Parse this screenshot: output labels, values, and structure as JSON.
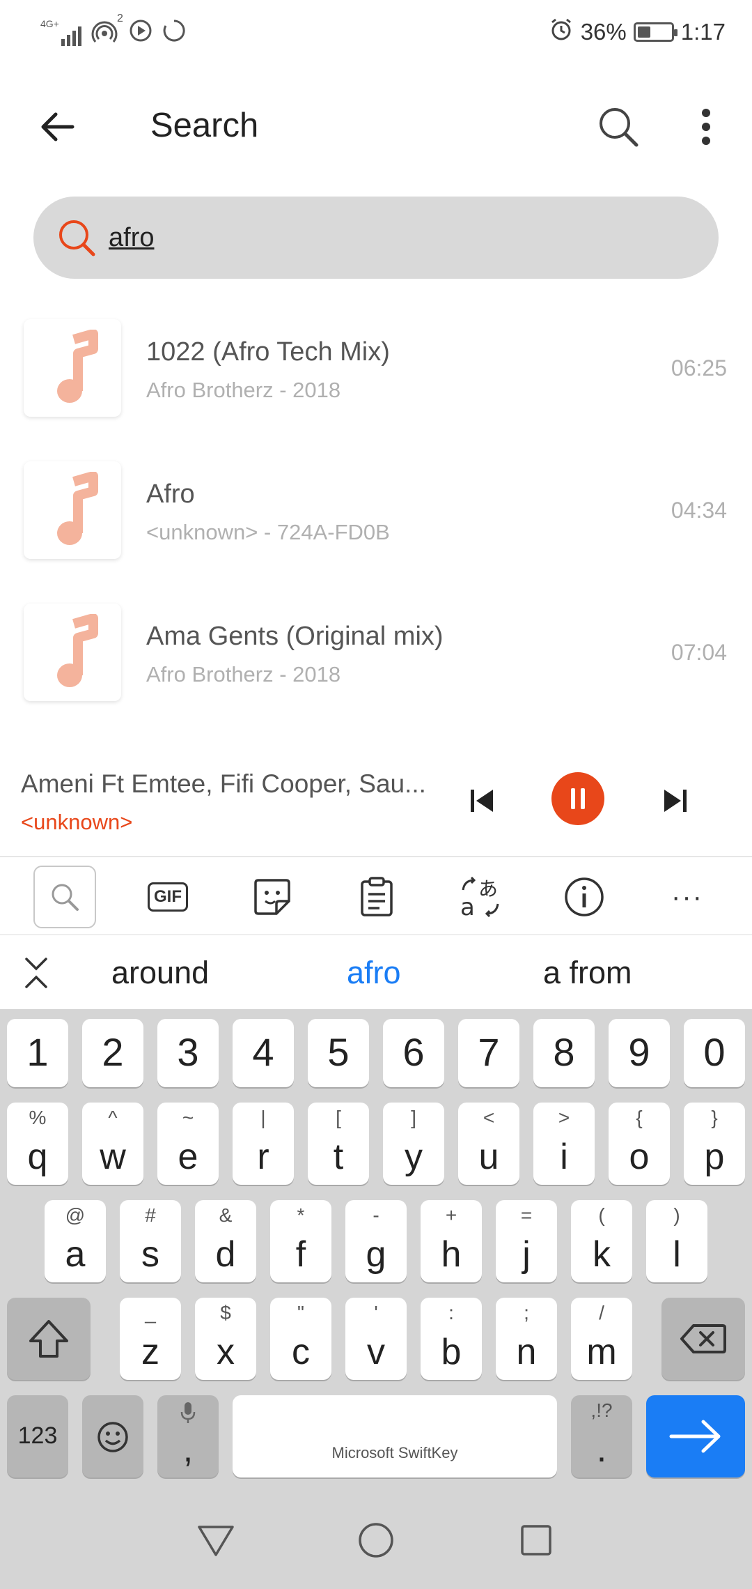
{
  "status_bar": {
    "network": "4G+",
    "hotspot_count": "2",
    "battery": "36%",
    "time": "1:17"
  },
  "appbar": {
    "title": "Search"
  },
  "search": {
    "value": "afro"
  },
  "songs": [
    {
      "title": "1022 (Afro Tech Mix)",
      "subtitle": "Afro Brotherz - 2018",
      "duration": "06:25"
    },
    {
      "title": "Afro",
      "subtitle": "<unknown> - 724A-FD0B",
      "duration": "04:34"
    },
    {
      "title": "Ama Gents (Original mix)",
      "subtitle": "Afro Brotherz - 2018",
      "duration": "07:04"
    }
  ],
  "player": {
    "title": "Ameni Ft Emtee, Fifi Cooper, Sau...",
    "artist": "<unknown>"
  },
  "keyboard_toolbar": {
    "gif_label": "GIF",
    "more_label": "···"
  },
  "suggestions": [
    "around",
    "afro",
    "a from"
  ],
  "keyboard": {
    "number_row": [
      "1",
      "2",
      "3",
      "4",
      "5",
      "6",
      "7",
      "8",
      "9",
      "0"
    ],
    "row1": [
      {
        "key": "q",
        "alt": "%"
      },
      {
        "key": "w",
        "alt": "^"
      },
      {
        "key": "e",
        "alt": "~"
      },
      {
        "key": "r",
        "alt": "|"
      },
      {
        "key": "t",
        "alt": "["
      },
      {
        "key": "y",
        "alt": "]"
      },
      {
        "key": "u",
        "alt": "<"
      },
      {
        "key": "i",
        "alt": ">"
      },
      {
        "key": "o",
        "alt": "{"
      },
      {
        "key": "p",
        "alt": "}"
      }
    ],
    "row2": [
      {
        "key": "a",
        "alt": "@"
      },
      {
        "key": "s",
        "alt": "#"
      },
      {
        "key": "d",
        "alt": "&"
      },
      {
        "key": "f",
        "alt": "*"
      },
      {
        "key": "g",
        "alt": "-"
      },
      {
        "key": "h",
        "alt": "+"
      },
      {
        "key": "j",
        "alt": "="
      },
      {
        "key": "k",
        "alt": "("
      },
      {
        "key": "l",
        "alt": ")"
      }
    ],
    "row3": [
      {
        "key": "z",
        "alt": "_"
      },
      {
        "key": "x",
        "alt": "$"
      },
      {
        "key": "c",
        "alt": "\""
      },
      {
        "key": "v",
        "alt": "'"
      },
      {
        "key": "b",
        "alt": ":"
      },
      {
        "key": "n",
        "alt": ";"
      },
      {
        "key": "m",
        "alt": "/"
      }
    ],
    "sym_label": "123",
    "comma": ",",
    "space_label": "Microsoft SwiftKey",
    "period": ".",
    "period_alt": ",!?"
  },
  "colors": {
    "accent": "#e8471a",
    "suggest_active": "#1a7df5",
    "note_icon": "#f4b39c",
    "enter_key": "#1a7df5"
  }
}
